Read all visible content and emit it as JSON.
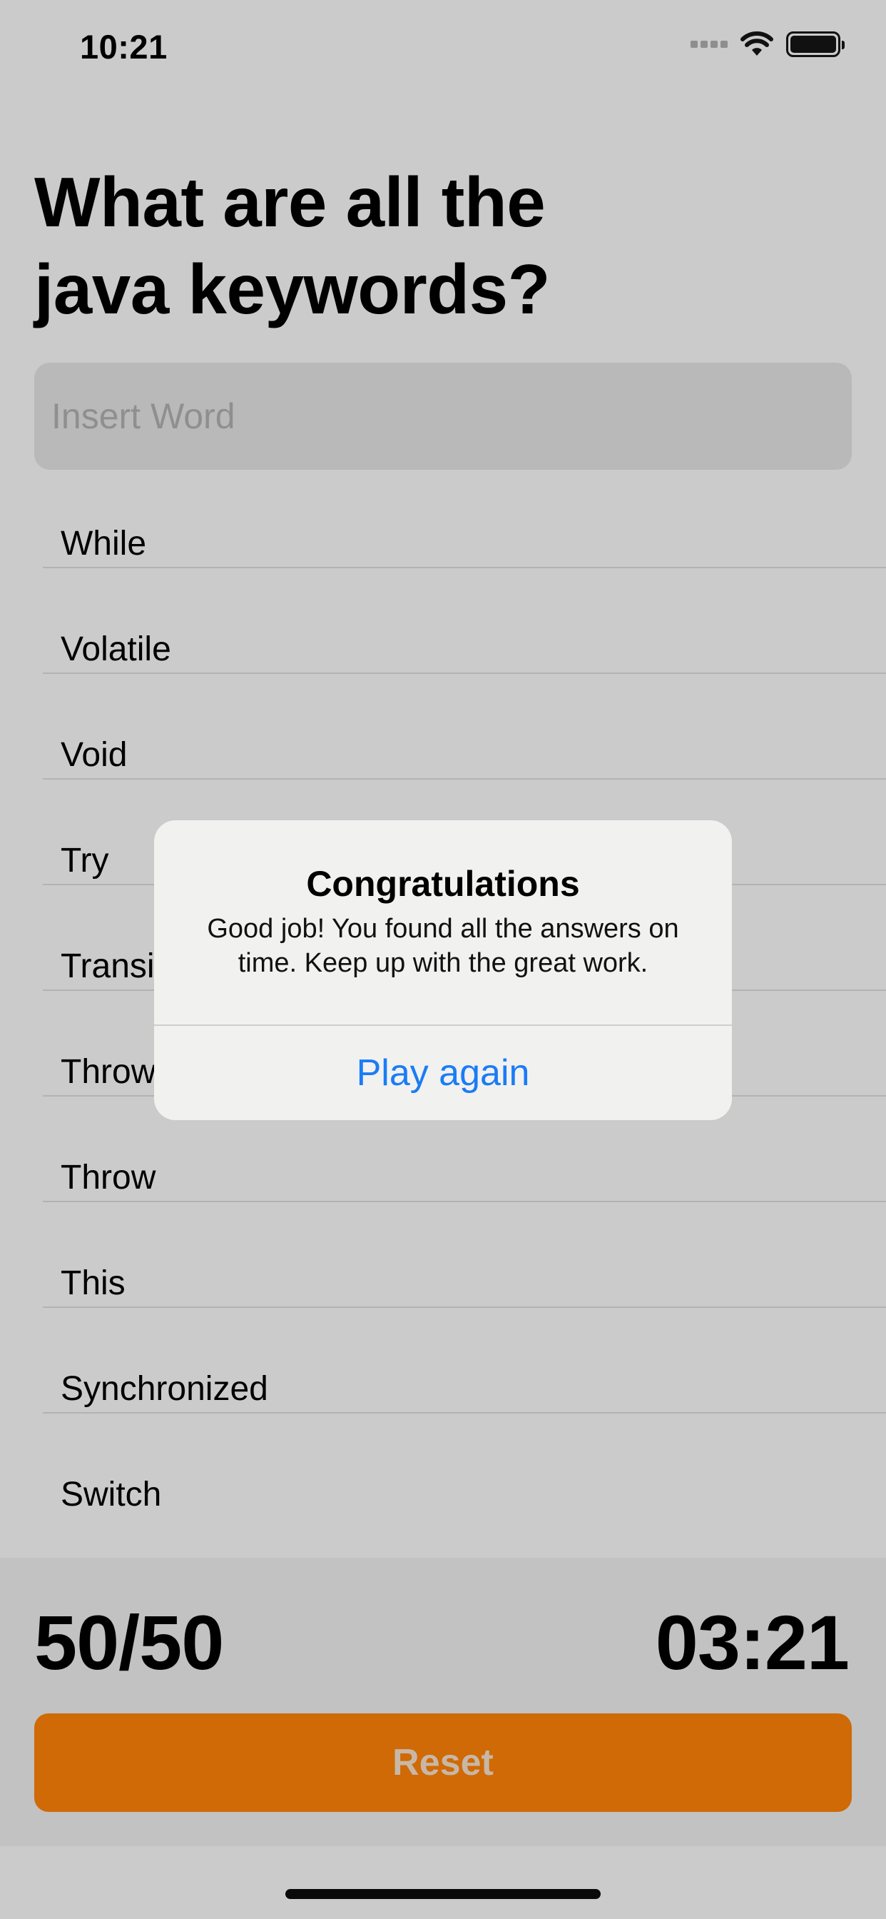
{
  "status_bar": {
    "time": "10:21"
  },
  "question": {
    "title": "What are all the java keywords?"
  },
  "search": {
    "placeholder": "Insert Word",
    "value": ""
  },
  "answers": [
    {
      "label": "While"
    },
    {
      "label": "Volatile"
    },
    {
      "label": "Void"
    },
    {
      "label": "Try"
    },
    {
      "label": "Transient"
    },
    {
      "label": "Throws"
    },
    {
      "label": "Throw"
    },
    {
      "label": "This"
    },
    {
      "label": "Synchronized"
    },
    {
      "label": "Switch"
    }
  ],
  "footer": {
    "score": "50/50",
    "timer": "03:21",
    "reset_label": "Reset"
  },
  "alert": {
    "title": "Congratulations",
    "message": "Good job! You found all the answers on time. Keep up with the great work.",
    "action_label": "Play again"
  },
  "colors": {
    "accent": "#cf6a06",
    "link": "#1a7cf5",
    "background": "#cbcbcb"
  }
}
